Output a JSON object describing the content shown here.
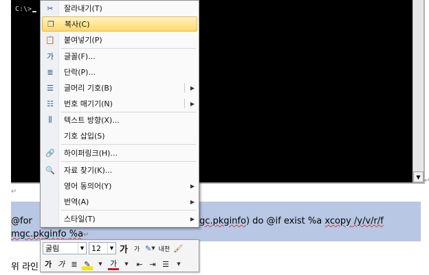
{
  "console": {
    "prompt": "C:\\>"
  },
  "context_menu": {
    "items": [
      {
        "icon": "cut-icon",
        "glyph": "✂",
        "label": "잘라내기(T)"
      },
      {
        "icon": "copy-icon",
        "glyph": "❐",
        "label": "복사(C)",
        "highlighted": true
      },
      {
        "icon": "paste-icon",
        "glyph": "📋",
        "label": "붙여넣기(P)"
      },
      {
        "icon": "font-icon",
        "glyph": "가",
        "label": "글꼴(F)..."
      },
      {
        "icon": "paragraph-icon",
        "glyph": "≣",
        "label": "단락(P)..."
      },
      {
        "icon": "bullets-icon",
        "glyph": "☰",
        "label": "글머리 기호(B)",
        "submenu": true
      },
      {
        "icon": "numbering-icon",
        "glyph": "☷",
        "label": "번호 매기기(N)",
        "submenu": true
      },
      {
        "icon": "text-direction-icon",
        "glyph": "⫼",
        "label": "텍스트 방향(X)..."
      },
      {
        "icon": "",
        "glyph": "",
        "label": "기호 삽입(S)"
      },
      {
        "icon": "hyperlink-icon",
        "glyph": "🔗",
        "label": "하이퍼링크(H)..."
      },
      {
        "icon": "research-icon",
        "glyph": "🔍",
        "label": "자료 찾기(K)..."
      },
      {
        "icon": "",
        "glyph": "",
        "label": "영어 동의어(Y)",
        "submenu": true
      },
      {
        "icon": "",
        "glyph": "",
        "label": "번역(A)",
        "submenu": true
      },
      {
        "icon": "",
        "glyph": "",
        "label": "스타일(T)",
        "submenu": true
      }
    ]
  },
  "document": {
    "para_mark": "↵",
    "line1_start": "@for ",
    "line1_mid": "gc.pkginfo",
    "line1_end": ") do @if  exist %a ",
    "line1_cmd": "xcopy",
    "line1_args": " /y/v/r/f",
    "line2_text": "mgc.pkginfo",
    "line2_var": " %a",
    "line3": "위 라인"
  },
  "mini_toolbar": {
    "font_name": "굴림",
    "font_size": "12",
    "bold": "가",
    "italic": "가",
    "grow_font": "가",
    "shrink_font": "가",
    "styles_label": "내천",
    "font_color": "가"
  },
  "colors": {
    "highlight": "#ffd96b",
    "selection": "#b7c7e4",
    "console_bg": "#000000"
  }
}
